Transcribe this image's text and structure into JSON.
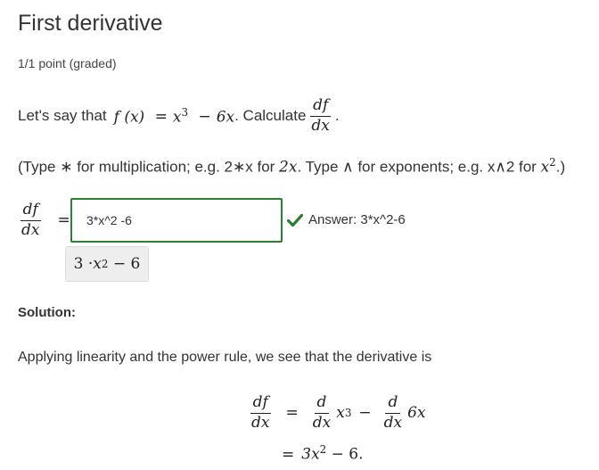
{
  "question": {
    "title": "First derivative",
    "points": "1/1 point (graded)",
    "prompt_lead": "Let's say that",
    "f_x": "f (x)",
    "equals": "=",
    "x": "x",
    "cube": "3",
    "minus": "−",
    "six_x": "6x",
    "period_after": ". Calculate",
    "df": "df",
    "dx": "dx",
    "dot": "."
  },
  "hint": {
    "part1": "(Type ∗ for multiplication; e.g. 2∗x for ",
    "two_x": "2x",
    "part2": ". Type ∧ for exponents; e.g. x∧2 for ",
    "x": "x",
    "sq": "2",
    "part3": ".)"
  },
  "answer": {
    "input_value": "3*x^2 -6",
    "feedback_label": "Answer: 3*x^2-6",
    "status_color": "#2e7d32",
    "preview": {
      "three_dot": "3 · ",
      "x": "x",
      "sq": "2",
      "tail": " − 6"
    }
  },
  "solution": {
    "label": "Solution:",
    "text": "Applying linearity and the power rule, we see that the derivative is",
    "df": "df",
    "dx": "dx",
    "d": "d",
    "x": "x",
    "cube": "3",
    "minus": "−",
    "six_x": "6x",
    "result_lead": "3x",
    "result_sq": "2",
    "result_tail": " − 6."
  }
}
